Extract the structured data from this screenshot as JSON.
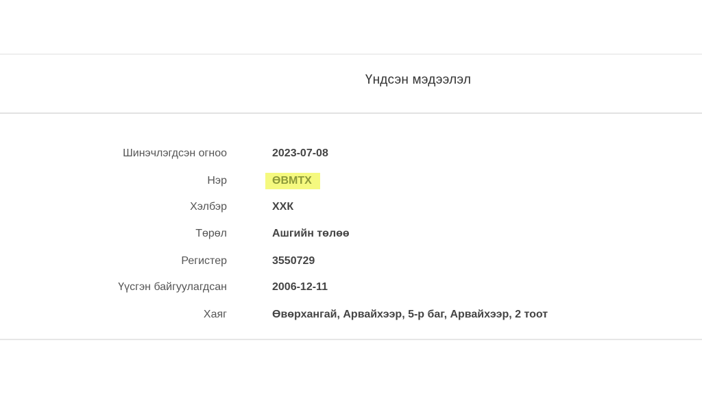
{
  "card": {
    "title": "Үндсэн мэдээлэл"
  },
  "info": {
    "rows": [
      {
        "label": "Шинэчлэгдсэн огноо",
        "value": "2023-07-08"
      },
      {
        "label": "Нэр",
        "value": "ӨВМТХ"
      },
      {
        "label": "Хэлбэр",
        "value": "ХХК"
      },
      {
        "label": "Төрөл",
        "value": "Ашгийн төлөө"
      },
      {
        "label": "Регистер",
        "value": "3550729"
      },
      {
        "label": "Үүсгэн байгуулагдсан",
        "value": "2006-12-11"
      },
      {
        "label": "Хаяг",
        "value": "Өвөрхангай, Арвайхээр, 5-р баг, Арвайхээр, 2 тоот"
      }
    ]
  },
  "colors": {
    "highlight": "#f5f97f",
    "highlight_text": "#8d9a3a"
  }
}
